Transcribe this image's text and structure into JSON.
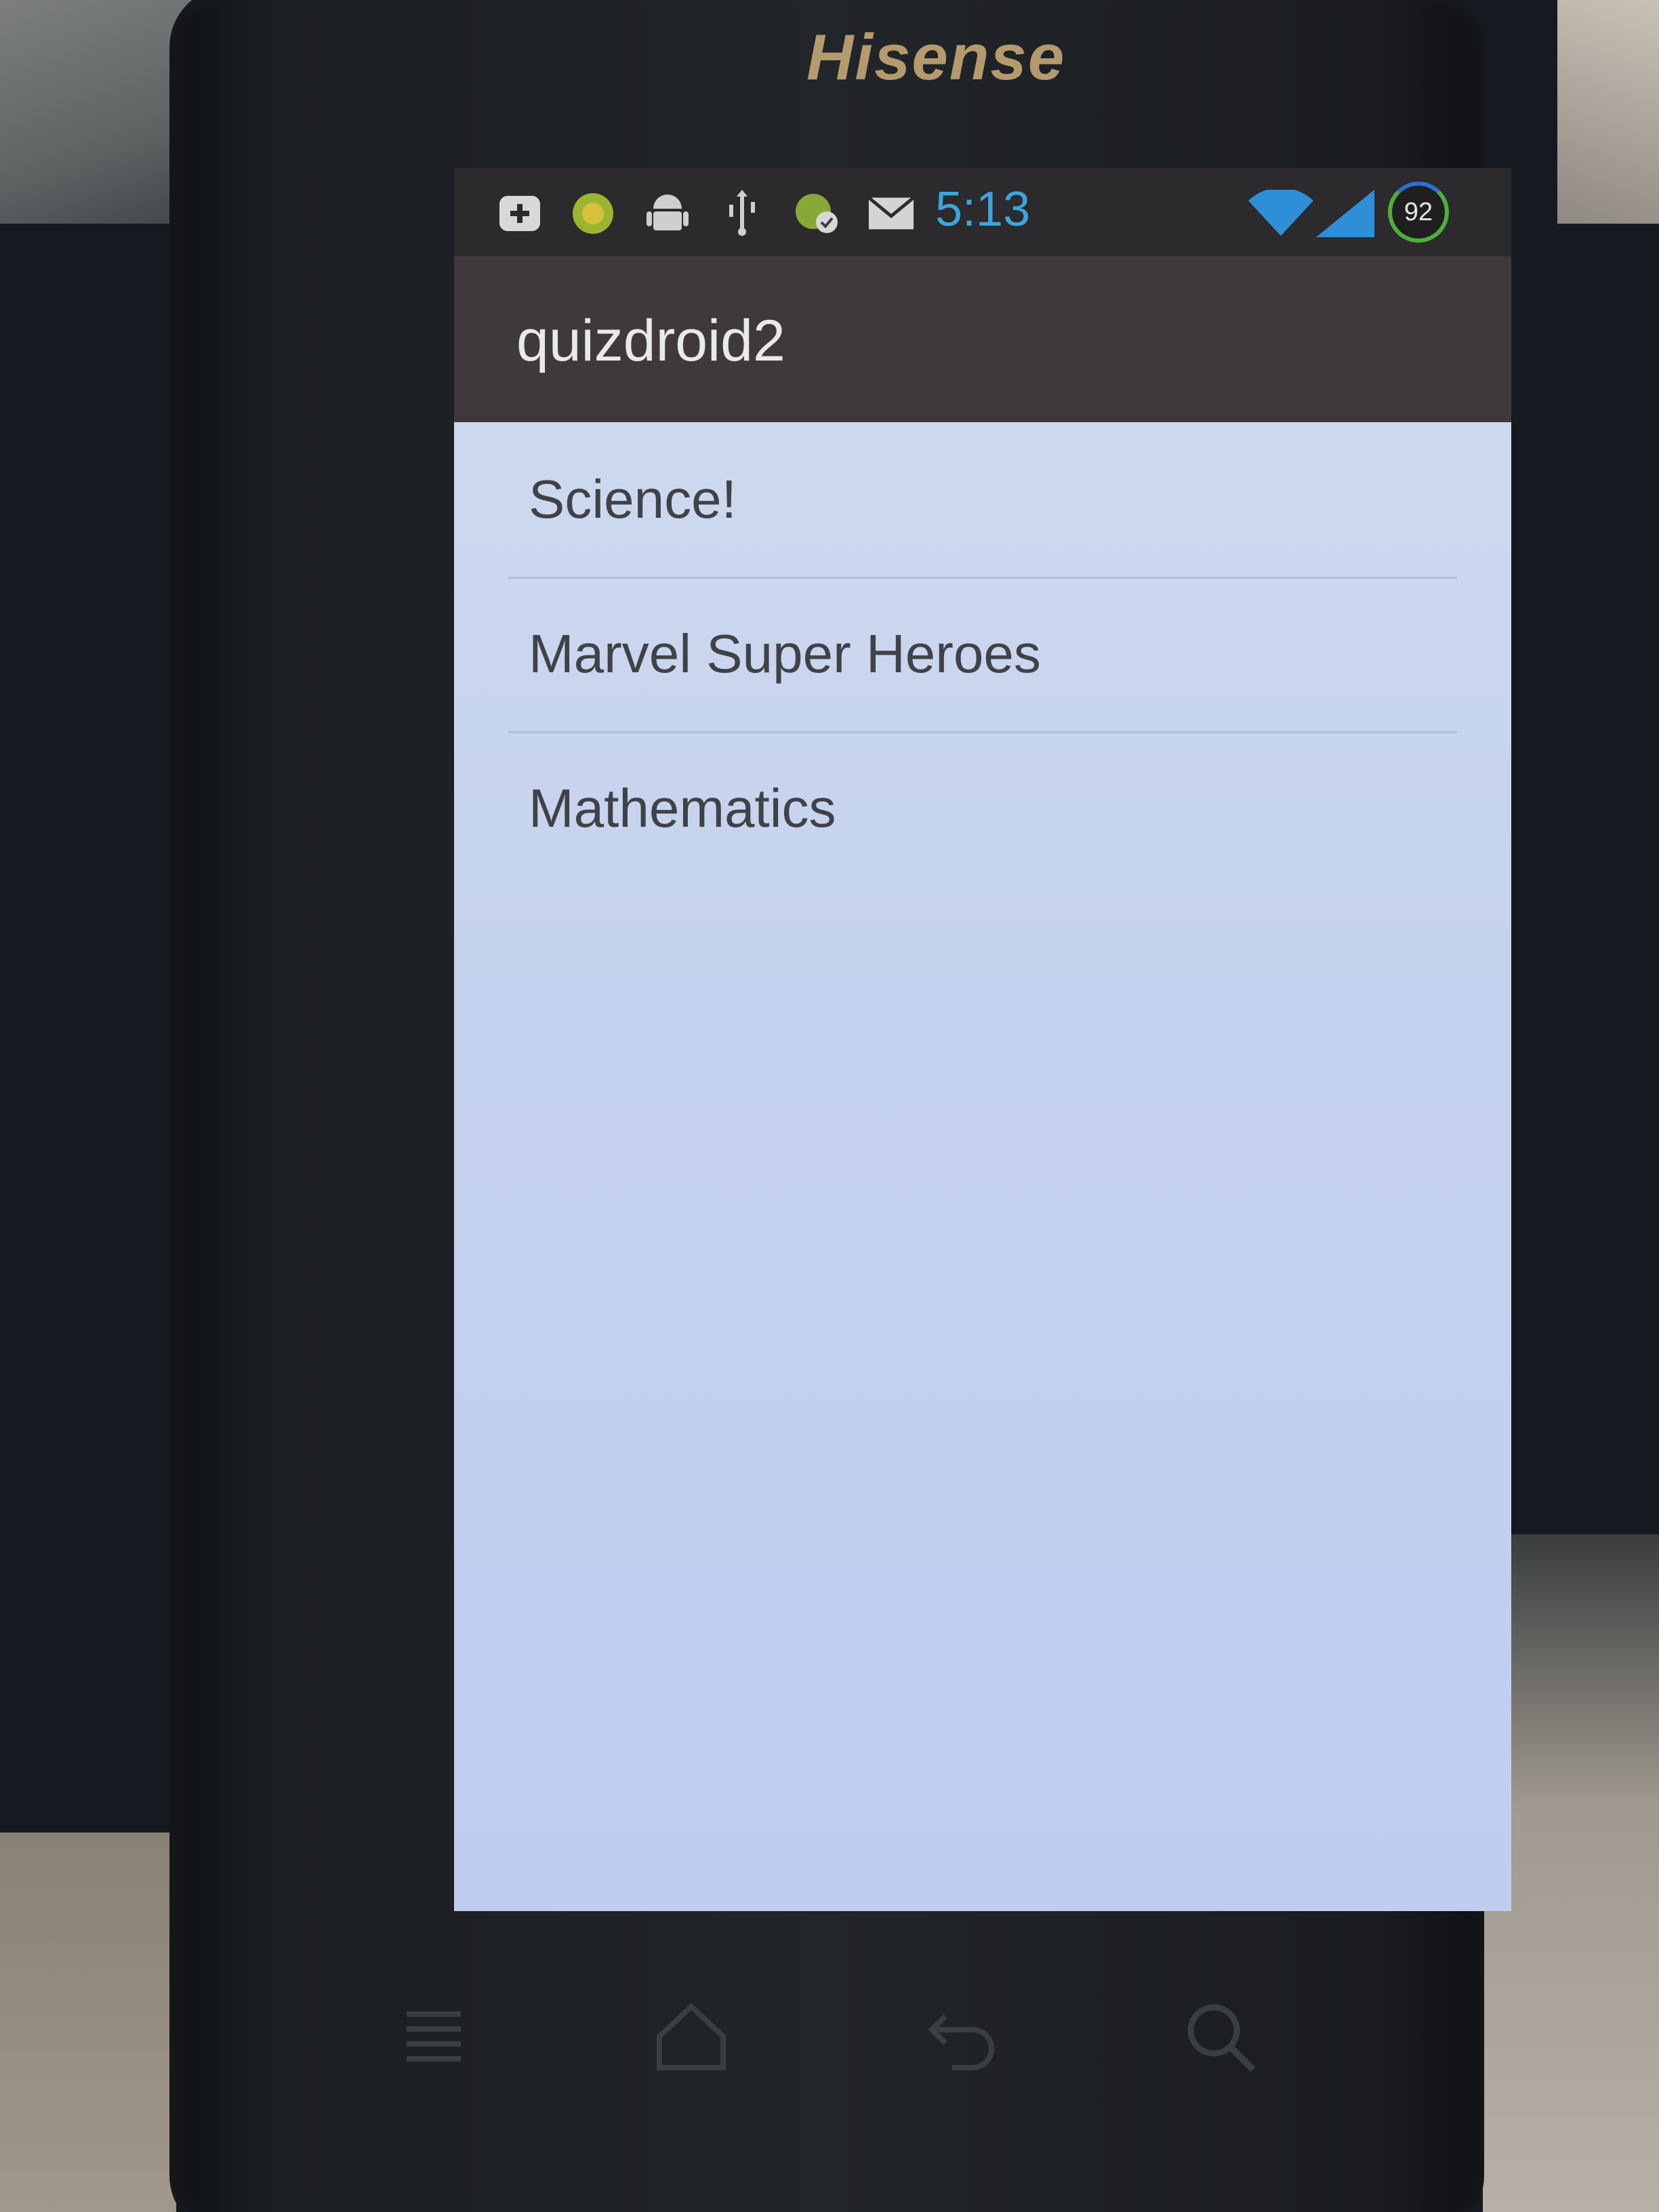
{
  "device": {
    "brand": "Hisense"
  },
  "status_bar": {
    "time": "5:13",
    "battery_level": "92",
    "icons": [
      "add-box-icon",
      "android-market-icon",
      "android-debug-icon",
      "usb-icon",
      "sync-icon",
      "mail-icon",
      "wifi-icon",
      "cell-signal-icon",
      "battery-icon"
    ]
  },
  "action_bar": {
    "title": "quizdroid2"
  },
  "quiz_list": {
    "items": [
      {
        "label": "Science!"
      },
      {
        "label": "Marvel Super Heroes"
      },
      {
        "label": "Mathematics"
      }
    ]
  },
  "nav_keys": [
    "menu-icon",
    "home-icon",
    "back-icon",
    "search-icon"
  ],
  "colors": {
    "brand_gold": "#b49a6c",
    "clock_blue": "#3aa6dc",
    "list_background": "#c4d1ee",
    "action_bar": "#3e3a3c"
  }
}
